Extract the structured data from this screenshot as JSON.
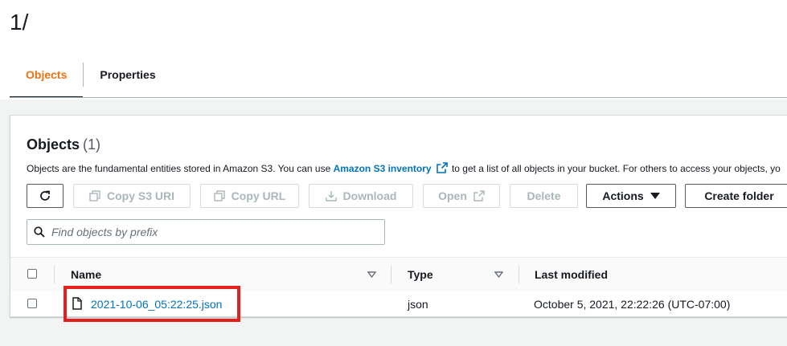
{
  "page": {
    "title": "1/"
  },
  "tabs": [
    {
      "label": "Objects",
      "active": true
    },
    {
      "label": "Properties",
      "active": false
    }
  ],
  "objects_panel": {
    "title": "Objects",
    "count": "(1)",
    "description_before": "Objects are the fundamental entities stored in Amazon S3. You can use ",
    "description_link": "Amazon S3 inventory",
    "description_after": " to get a list of all objects in your bucket. For others to access your objects, yo"
  },
  "toolbar": {
    "refresh_icon": "refresh-icon",
    "copy_s3_uri": "Copy S3 URI",
    "copy_url": "Copy URL",
    "download": "Download",
    "open": "Open",
    "delete": "Delete",
    "actions": "Actions",
    "create_folder": "Create folder"
  },
  "search": {
    "placeholder": "Find objects by prefix",
    "value": ""
  },
  "table": {
    "columns": [
      "Name",
      "Type",
      "Last modified"
    ],
    "rows": [
      {
        "name": "2021-10-06_05:22:25.json",
        "type": "json",
        "last_modified": "October 5, 2021, 22:22:26 (UTC-07:00)"
      }
    ]
  },
  "colors": {
    "accent_tab": "#ec7211",
    "link": "#0073bb",
    "highlight": "#e5201c"
  }
}
